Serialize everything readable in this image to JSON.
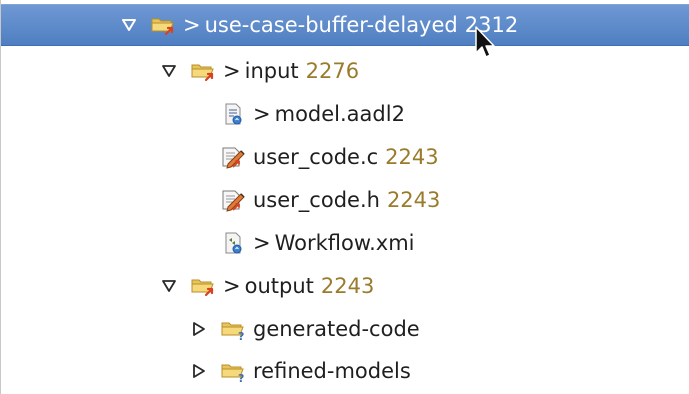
{
  "tree": {
    "root": {
      "prefix": ">",
      "label": "use-case-buffer-delayed",
      "revision": "2312",
      "icon": "folder-outgoing-icon",
      "expanded": true,
      "selected": true
    },
    "input": {
      "prefix": ">",
      "label": "input",
      "revision": "2276",
      "icon": "folder-outgoing-icon",
      "expanded": true
    },
    "model_aadl2": {
      "prefix": ">",
      "label": "model.aadl2",
      "icon": "model-file-icon"
    },
    "user_code_c": {
      "label": "user_code.c",
      "revision": "2243",
      "icon": "edited-file-icon"
    },
    "user_code_h": {
      "label": "user_code.h",
      "revision": "2243",
      "icon": "edited-file-icon"
    },
    "workflow_xmi": {
      "prefix": ">",
      "label": "Workflow.xmi",
      "icon": "workflow-file-icon"
    },
    "output": {
      "prefix": ">",
      "label": "output",
      "revision": "2243",
      "icon": "folder-outgoing-icon",
      "expanded": true
    },
    "generated_code": {
      "label": "generated-code",
      "icon": "folder-unversioned-icon",
      "expanded": false
    },
    "refined_models": {
      "label": "refined-models",
      "icon": "folder-unversioned-icon",
      "expanded": false
    }
  },
  "colors": {
    "selection": "#5a87c8",
    "revision_text": "#9a7b2c",
    "folder": "#e8c45a",
    "arrow_badge": "#d8421f",
    "question_badge": "#3a6fb6"
  }
}
